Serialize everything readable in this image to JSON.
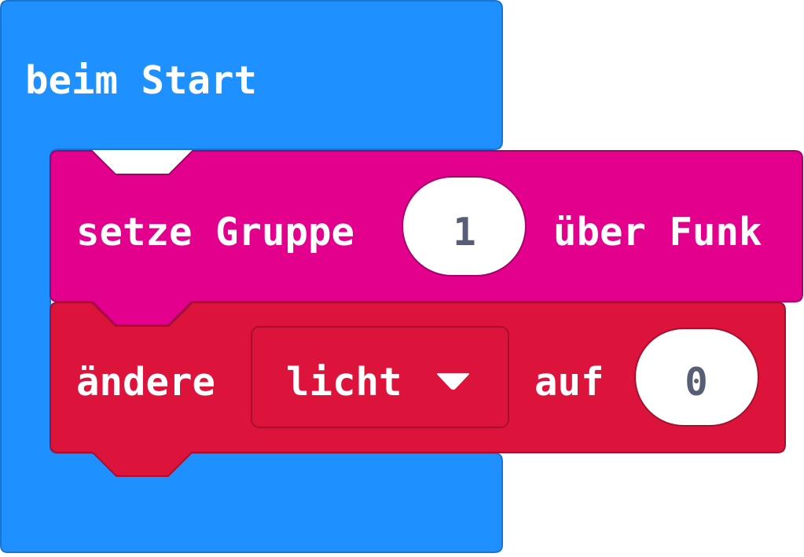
{
  "workspace": {
    "on_start_block": {
      "label": "beim Start",
      "color": "#1E90FF"
    },
    "radio_group_block": {
      "label_before": "setze Gruppe",
      "value": "1",
      "label_after": "über Funk",
      "color": "#E3008C"
    },
    "change_variable_block": {
      "label_before": "ändere",
      "variable": "licht",
      "dropdown_icon": "triangle-down-icon",
      "label_after": "auf",
      "value": "0",
      "color": "#DC143C"
    }
  }
}
